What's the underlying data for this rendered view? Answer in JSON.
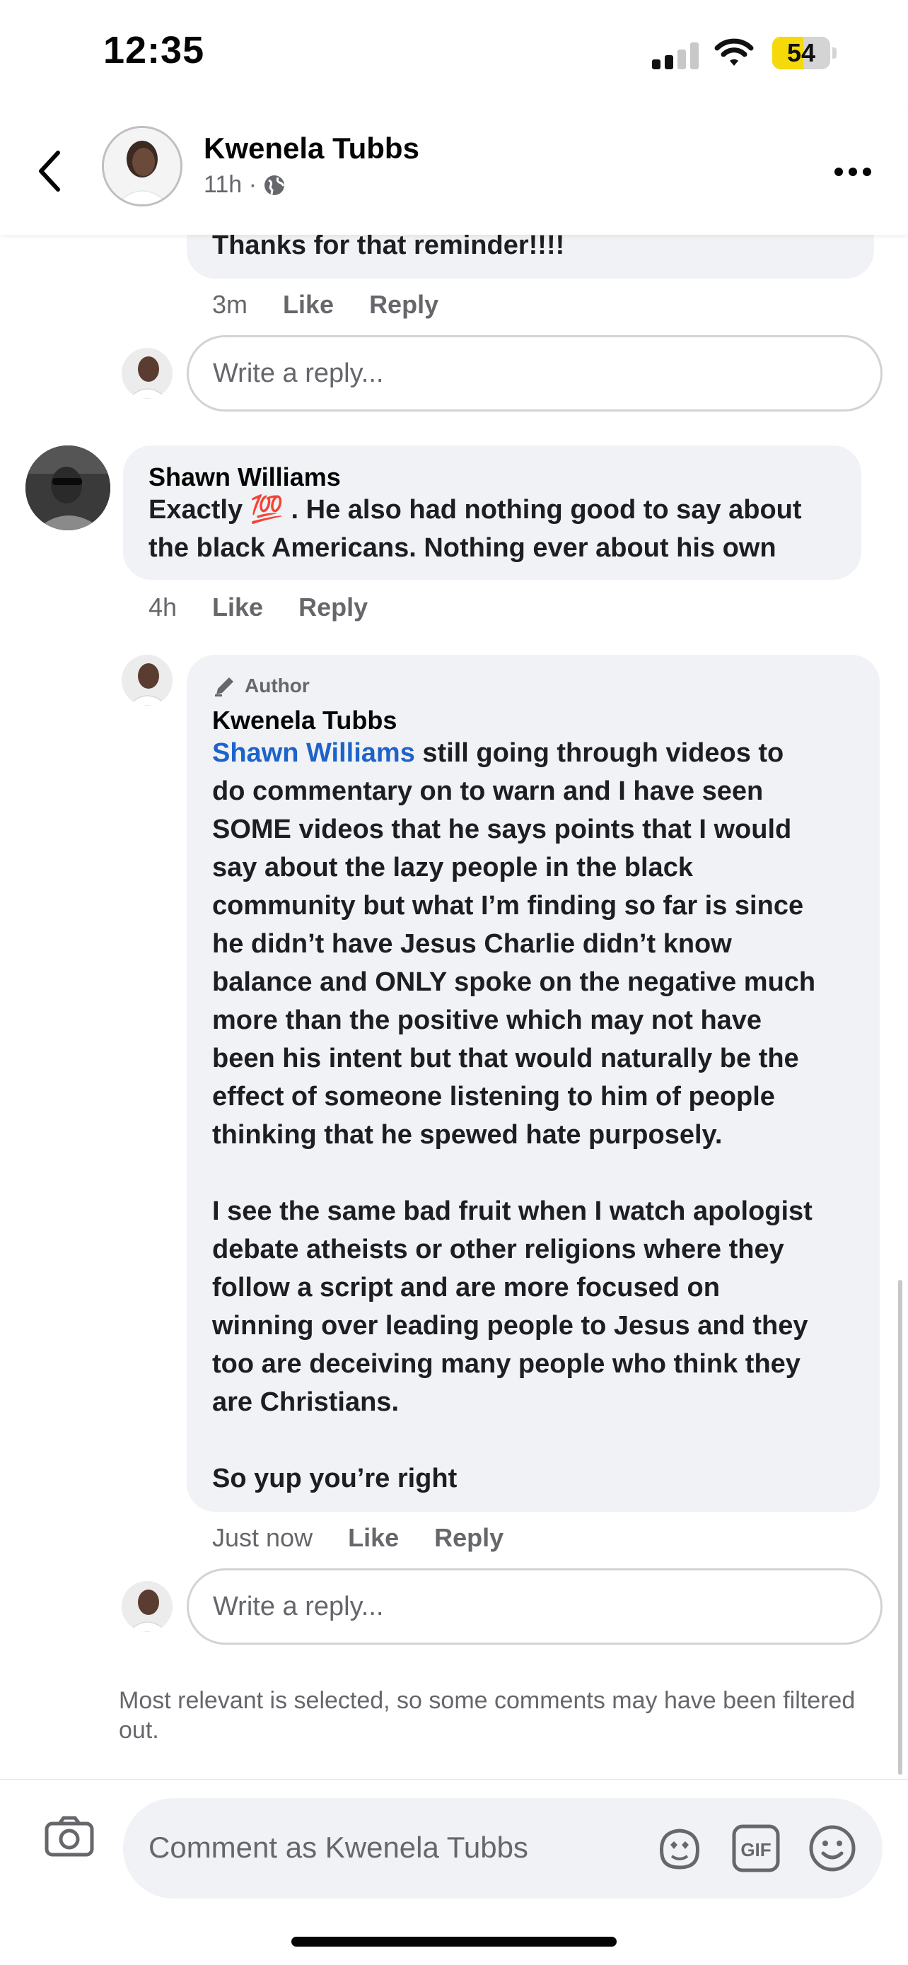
{
  "status_bar": {
    "time": "12:35",
    "battery": "54",
    "battery_level": 0.54
  },
  "header": {
    "name": "Kwenela Tubbs",
    "meta": "11h ·"
  },
  "top_comment": {
    "text": "Thanks for that reminder!!!!",
    "time": "3m",
    "like": "Like",
    "reply": "Reply",
    "reply_placeholder": "Write a reply..."
  },
  "shawn_comment": {
    "name": "Shawn Williams",
    "text_before_emoji": "Exactly ",
    "emoji": "💯",
    "text_line1_after": " . He also had nothing good to say about",
    "text_line2": "the black Americans. Nothing ever about his own",
    "time": "4h",
    "like": "Like",
    "reply": "Reply"
  },
  "author_reply": {
    "badge": "Author",
    "name": "Kwenela Tubbs",
    "mention": "Shawn Williams",
    "lines_p1": [
      " still going through videos to",
      "do commentary on to warn and I have seen",
      "SOME videos that he says points that I would",
      "say about the lazy people in the black",
      "community but what I’m finding so far is since",
      "he didn’t have Jesus Charlie didn’t know",
      "balance and ONLY spoke on the negative much",
      "more than the positive which may not have",
      "been his intent but that would naturally be the",
      "effect of someone listening to him of people",
      "thinking that he spewed hate purposely."
    ],
    "lines_p2": [
      "I see the same bad fruit when I watch apologist",
      "debate atheists or other religions where they",
      "follow a script and are more focused on",
      "winning over leading people to Jesus and they",
      "too are deceiving many people who think they",
      "are Christians."
    ],
    "lines_p3": [
      "So yup you’re right"
    ],
    "time": "Just now",
    "like": "Like",
    "reply": "Reply",
    "reply_placeholder": "Write a reply..."
  },
  "filter_note": "Most relevant is selected, so some comments may have been filtered out.",
  "bottom_bar": {
    "placeholder": "Comment as Kwenela Tubbs",
    "gif": "GIF"
  }
}
